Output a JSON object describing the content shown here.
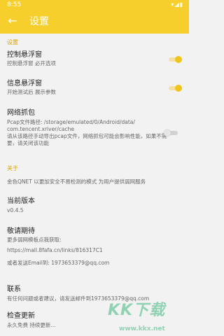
{
  "status": {
    "time": "8:55",
    "icons": "▾◢▮"
  },
  "appbar": {
    "back_icon": "arrow-left",
    "title": "设置"
  },
  "sections": {
    "settings": "设置",
    "about": "关于"
  },
  "items": {
    "control_float": {
      "title": "控制悬浮窗",
      "subtitle": "控制悬浮窗 必开选项",
      "toggle": true
    },
    "info_float": {
      "title": "信息悬浮窗",
      "subtitle": "开始测试后 展示参数",
      "toggle": true
    },
    "capture": {
      "title": "网络抓包",
      "line1": "Pcap文件路径: /storage/emulated/0/Android/data/",
      "line2": "com.tencent.xriver/cache",
      "line3": "请从该路径手动导出pcap文件，网络抓包可能会影响性能，如果不需要，请关闭该功能",
      "toggle": false
    },
    "about_text": "金色QNET 以更加安全不易检测的模式 为用户提供弱网服务",
    "version": {
      "title": "当前版本",
      "value": "v0.4.5"
    },
    "stay_tuned": {
      "title": "敬请期待",
      "subtitle": "更多弱网模板点我获取:",
      "link": "https://mall.8fafa.cn/links/816317C1",
      "email": "或者发送Email到: 1973653379@qq.com"
    },
    "contact": {
      "title": "联系",
      "subtitle": "有任何问题或者建议，请发送邮件到1973653379@qq.com"
    },
    "update": {
      "title": "检查更新",
      "subtitle": "永久免费 持续更新..."
    }
  },
  "watermark": {
    "brand": "KK下载",
    "url": "www.kkx.net"
  },
  "colors": {
    "accent": "#f7cf2c",
    "toggle_on": "#f0c419"
  }
}
